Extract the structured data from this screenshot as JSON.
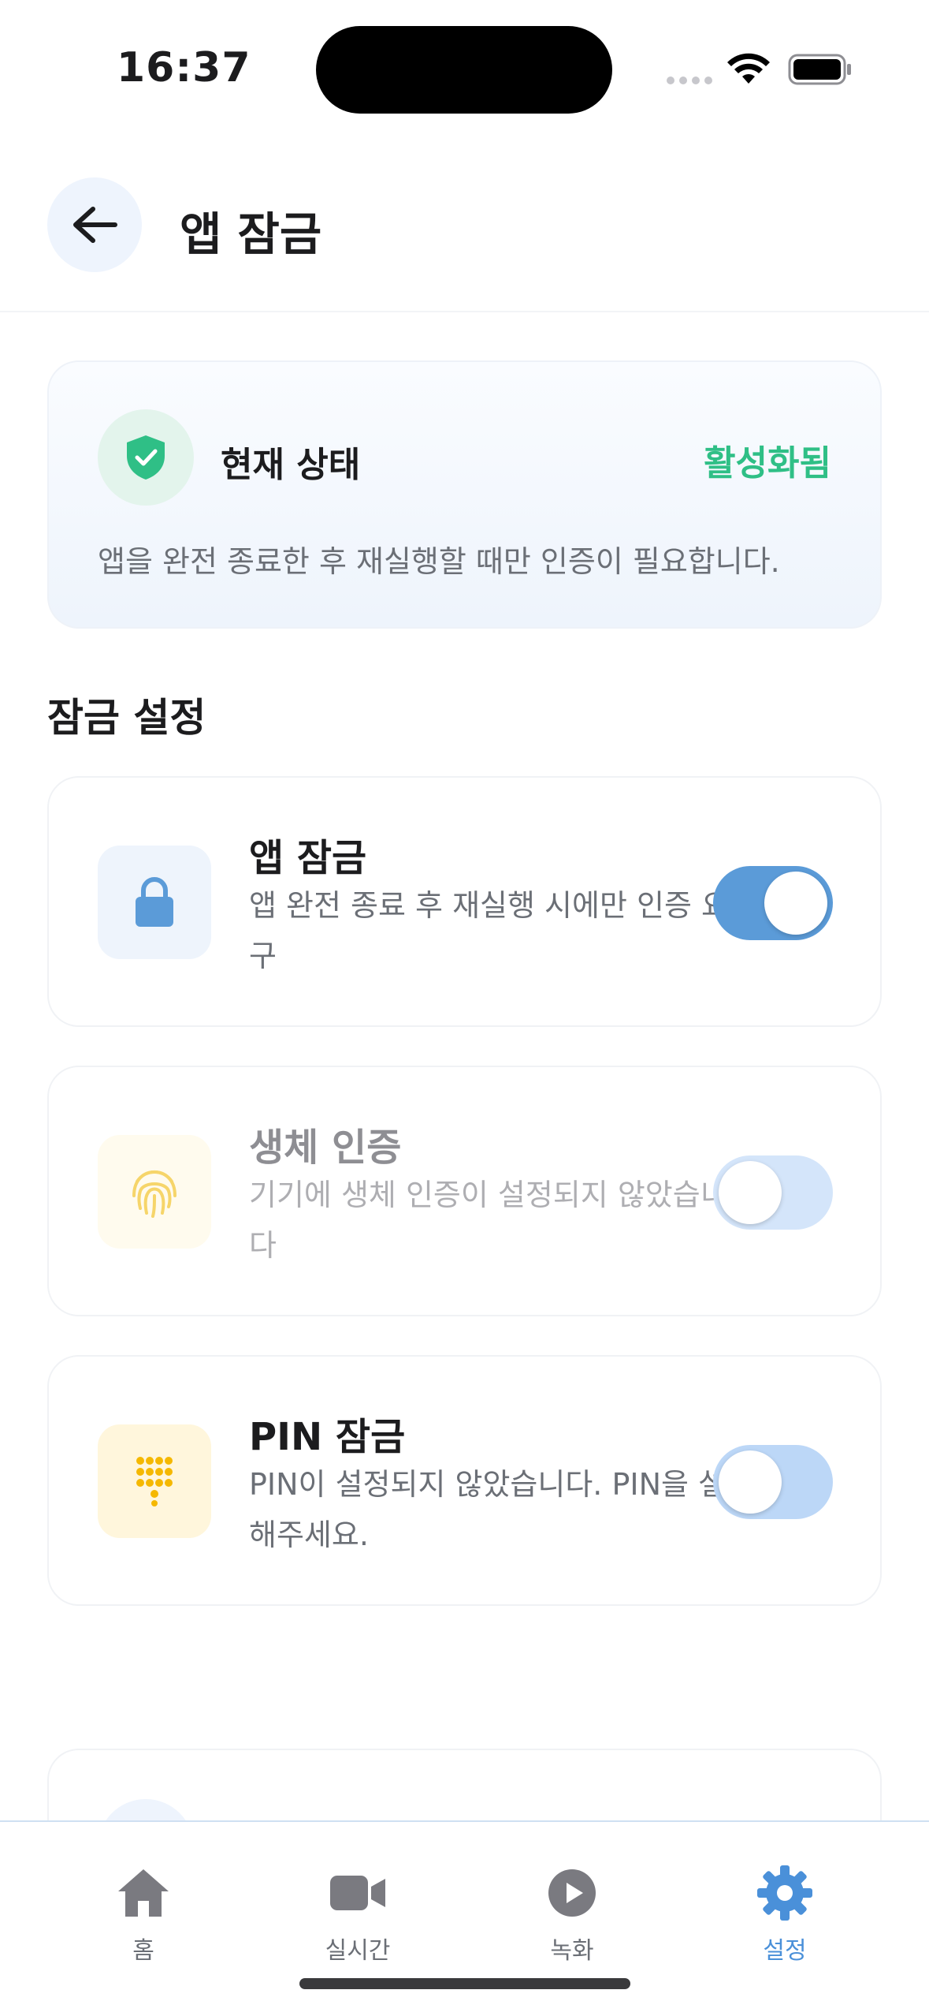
{
  "status_bar": {
    "time": "16:37"
  },
  "header": {
    "title": "앱 잠금"
  },
  "status_card": {
    "label": "현재 상태",
    "value": "활성화됨",
    "description": "앱을 완전 종료한 후 재실행할 때만 인증이 필요합니다.",
    "value_color": "#2fbf86"
  },
  "section": {
    "title": "잠금 설정"
  },
  "settings": [
    {
      "title": "앱 잠금",
      "description": "앱 완전 종료 후 재실행 시에만 인증 요구",
      "icon": "lock-icon",
      "enabled": true
    },
    {
      "title": "생체 인증",
      "description": "기기에 생체 인증이 설정되지 않았습니다",
      "icon": "fingerprint-icon",
      "enabled": false
    },
    {
      "title": "PIN 잠금",
      "description": "PIN이 설정되지 않았습니다. PIN을 설정해주세요.",
      "icon": "keypad-icon",
      "enabled": false
    }
  ],
  "tabs": [
    {
      "label": "홈",
      "icon": "home-icon",
      "active": false
    },
    {
      "label": "실시간",
      "icon": "video-camera-icon",
      "active": false
    },
    {
      "label": "녹화",
      "icon": "play-icon",
      "active": false
    },
    {
      "label": "설정",
      "icon": "gear-icon",
      "active": true
    }
  ],
  "colors": {
    "accent": "#4a90d9",
    "toggle_on": "#5b9bd8",
    "success": "#2fbf86"
  }
}
